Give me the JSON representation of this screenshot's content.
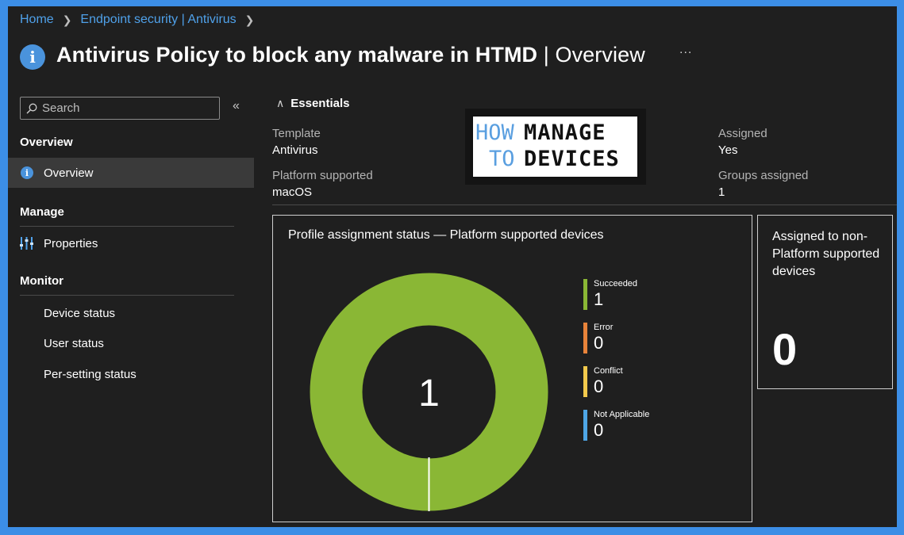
{
  "breadcrumb": [
    "Home",
    "Endpoint security | Antivirus"
  ],
  "title": {
    "main": "Antivirus Policy to block any malware in HTMD",
    "divider": " | ",
    "sub": "Overview",
    "more": "..."
  },
  "search": {
    "placeholder": "Search"
  },
  "sidebar": {
    "sections": [
      {
        "heading": "Overview",
        "items": [
          {
            "label": "Overview",
            "icon": "info-icon",
            "selected": true
          }
        ]
      },
      {
        "heading": "Manage",
        "items": [
          {
            "label": "Properties",
            "icon": "sliders-icon"
          }
        ]
      },
      {
        "heading": "Monitor",
        "items": [
          {
            "label": "Device status"
          },
          {
            "label": "User status"
          },
          {
            "label": "Per-setting status"
          }
        ]
      }
    ]
  },
  "essentials": {
    "heading": "Essentials",
    "template_label": "Template",
    "template_value": "Antivirus",
    "platform_label": "Platform supported",
    "platform_value": "macOS",
    "assigned_label": "Assigned",
    "assigned_value": "Yes",
    "groups_label": "Groups assigned",
    "groups_value": "1"
  },
  "logo": {
    "how": "HOW",
    "to": "TO",
    "manage": "MANAGE",
    "devices": "DEVICES"
  },
  "status_card": {
    "title": "Profile assignment status — Platform supported devices",
    "center_total": "1",
    "legend": [
      {
        "name": "Succeeded",
        "count": "1",
        "color": "#8ab735"
      },
      {
        "name": "Error",
        "count": "0",
        "color": "#e8833a"
      },
      {
        "name": "Conflict",
        "count": "0",
        "color": "#f2c94c"
      },
      {
        "name": "Not Applicable",
        "count": "0",
        "color": "#4ea6e6"
      }
    ]
  },
  "nonplatform_card": {
    "title": "Assigned to non-Platform supported devices",
    "count": "0"
  },
  "colors": {
    "accent": "#4fa1ea",
    "background": "#1f1f1f",
    "selected_row": "#3a3a3a",
    "frame": "#3c8ee6"
  }
}
